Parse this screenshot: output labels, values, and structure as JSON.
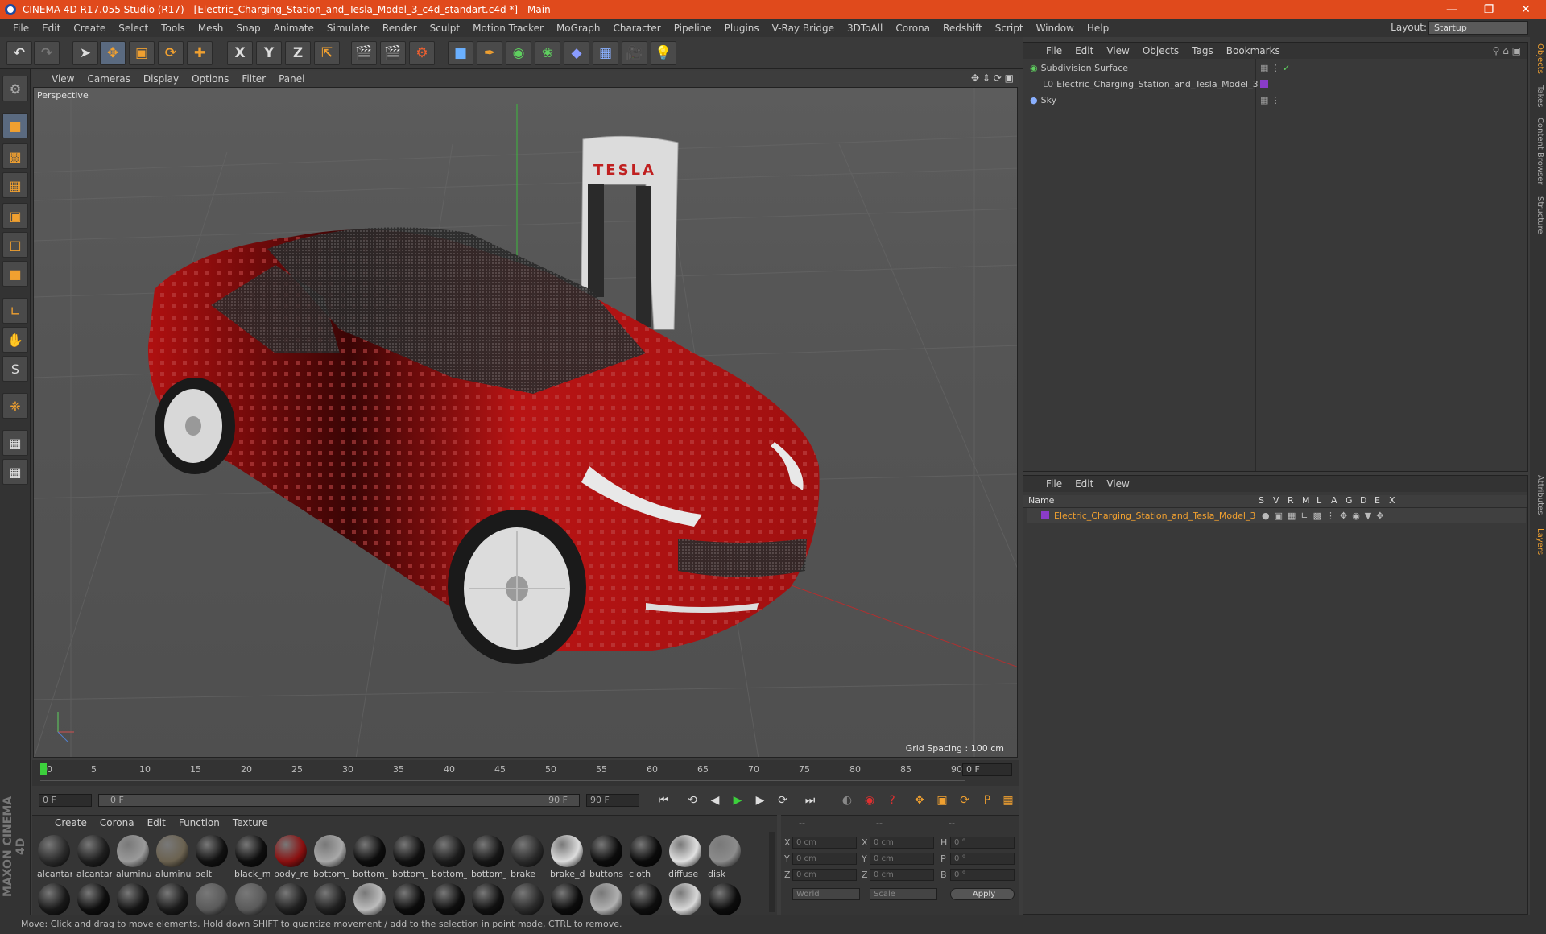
{
  "window": {
    "title": "CINEMA 4D R17.055 Studio (R17) - [Electric_Charging_Station_and_Tesla_Model_3_c4d_standart.c4d *] - Main"
  },
  "menu": [
    "File",
    "Edit",
    "Create",
    "Select",
    "Tools",
    "Mesh",
    "Snap",
    "Animate",
    "Simulate",
    "Render",
    "Sculpt",
    "Motion Tracker",
    "MoGraph",
    "Character",
    "Pipeline",
    "Plugins",
    "V-Ray Bridge",
    "3DToAll",
    "Corona",
    "Redshift",
    "Script",
    "Window",
    "Help"
  ],
  "layout": {
    "label": "Layout:",
    "value": "Startup"
  },
  "toolbar": {
    "x_label": "X",
    "y_label": "Y",
    "z_label": "Z"
  },
  "viewport": {
    "menu": [
      "View",
      "Cameras",
      "Display",
      "Options",
      "Filter",
      "Panel"
    ],
    "label": "Perspective",
    "grid_spacing": "Grid Spacing : 100 cm",
    "brand": "TESLA"
  },
  "timeline": {
    "ticks": [
      "0",
      "5",
      "10",
      "15",
      "20",
      "25",
      "30",
      "35",
      "40",
      "45",
      "50",
      "55",
      "60",
      "65",
      "70",
      "75",
      "80",
      "85",
      "90"
    ],
    "frame": "0 F"
  },
  "transport": {
    "start": "0 F",
    "range_start": "0 F",
    "range_end": "90 F",
    "end": "90 F"
  },
  "materials": {
    "menu": [
      "Create",
      "Corona",
      "Edit",
      "Function",
      "Texture"
    ],
    "row1": [
      {
        "name": "alcantar",
        "color": "#2a2a2a"
      },
      {
        "name": "alcantar",
        "color": "#1e1e1e"
      },
      {
        "name": "aluminu",
        "color": "#9a9a9a"
      },
      {
        "name": "aluminu",
        "color": "#6b6250"
      },
      {
        "name": "belt",
        "color": "#111"
      },
      {
        "name": "black_m",
        "color": "#0e0e0e"
      },
      {
        "name": "body_re",
        "color": "#8a1010"
      },
      {
        "name": "bottom_",
        "color": "#a8a8a8"
      },
      {
        "name": "bottom_",
        "color": "#0d0d0d"
      },
      {
        "name": "bottom_",
        "color": "#111"
      },
      {
        "name": "bottom_",
        "color": "#1c1c1c"
      },
      {
        "name": "bottom_",
        "color": "#161616"
      },
      {
        "name": "brake",
        "color": "#2a2a2a"
      },
      {
        "name": "brake_d",
        "color": "#dcdcdc"
      },
      {
        "name": "buttons",
        "color": "#0c0c0c"
      },
      {
        "name": "cloth",
        "color": "#0b0b0b"
      },
      {
        "name": "diffuse",
        "color": "#e0e0e0"
      },
      {
        "name": "disk",
        "color": "#8c8c8c"
      }
    ],
    "row2": [
      "#181818",
      "#0e0e0e",
      "#141414",
      "#1a1a1a",
      "#5a5a5a",
      "#5a5a5a",
      "#202020",
      "#202020",
      "#bcbcbc",
      "#0c0c0c",
      "#0e0e0e",
      "#111",
      "#2a2a2a",
      "#0c0c0c",
      "#b0b0b0",
      "#0e0e0e",
      "#d8d8d8",
      "#0c0c0c"
    ]
  },
  "coords": {
    "headers": [
      "--",
      "--",
      "--"
    ],
    "rows": [
      {
        "a": "X",
        "av": "0 cm",
        "b": "X",
        "bv": "0 cm",
        "c": "H",
        "cv": "0 °"
      },
      {
        "a": "Y",
        "av": "0 cm",
        "b": "Y",
        "bv": "0 cm",
        "c": "P",
        "cv": "0 °"
      },
      {
        "a": "Z",
        "av": "0 cm",
        "b": "Z",
        "bv": "0 cm",
        "c": "B",
        "cv": "0 °"
      }
    ],
    "world": "World",
    "scale": "Scale",
    "apply": "Apply"
  },
  "objects": {
    "menu": [
      "File",
      "Edit",
      "View",
      "Objects",
      "Tags",
      "Bookmarks"
    ],
    "items": [
      "Subdivision Surface",
      "Electric_Charging_Station_and_Tesla_Model_3",
      "Sky"
    ]
  },
  "layers": {
    "menu": [
      "File",
      "Edit",
      "View"
    ],
    "columns": [
      "Name",
      "S",
      "V",
      "R",
      "M",
      "L",
      "A",
      "G",
      "D",
      "E",
      "X"
    ],
    "item": "Electric_Charging_Station_and_Tesla_Model_3"
  },
  "righttabs": [
    "Objects",
    "Takes",
    "Content Browser",
    "Structure",
    "Attributes",
    "Layers"
  ],
  "status": "Move: Click and drag to move elements. Hold down SHIFT to quantize movement / add to the selection in point mode, CTRL to remove.",
  "brand": "MAXON CINEMA 4D",
  "colors": {
    "title_bar": "#e04a1c",
    "accent": "#f0a030",
    "layer_color": "#8a3cc8"
  }
}
